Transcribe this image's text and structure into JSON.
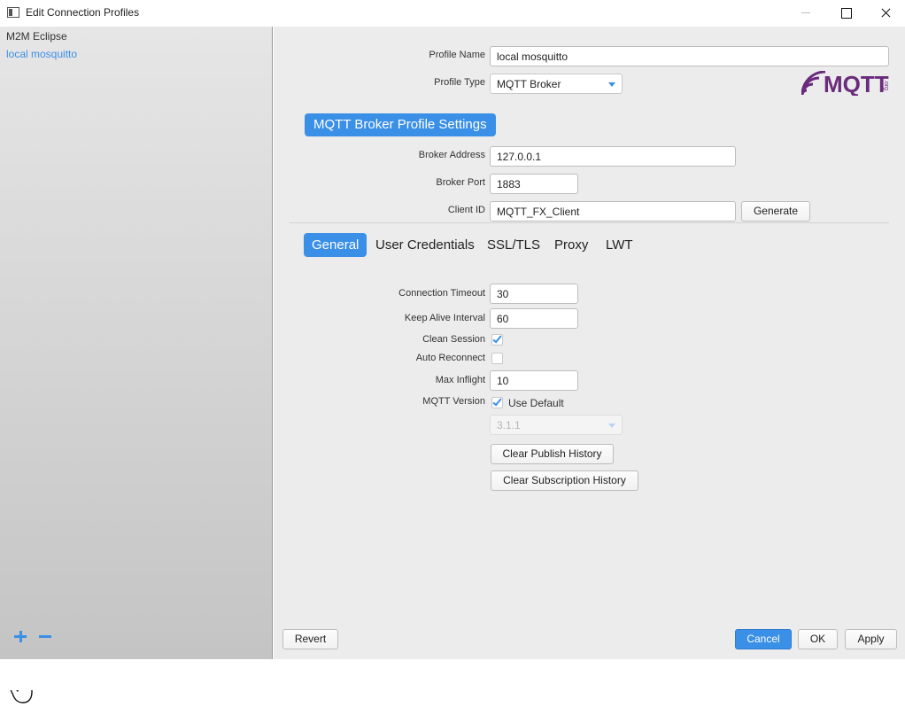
{
  "window": {
    "title": "Edit Connection Profiles"
  },
  "sidebar": {
    "profiles": [
      {
        "label": "M2M Eclipse"
      },
      {
        "label": "local mosquitto"
      }
    ]
  },
  "profile": {
    "name_label": "Profile Name",
    "name_value": "local mosquitto",
    "type_label": "Profile Type",
    "type_value": "MQTT Broker",
    "logo_text": "MQTT",
    "logo_subtext": ".org"
  },
  "broker": {
    "section_title": "MQTT Broker Profile Settings",
    "address_label": "Broker Address",
    "address_value": "127.0.0.1",
    "port_label": "Broker Port",
    "port_value": "1883",
    "client_id_label": "Client ID",
    "client_id_value": "MQTT_FX_Client",
    "generate_label": "Generate"
  },
  "tabs": [
    {
      "label": "General",
      "active": true
    },
    {
      "label": "User Credentials",
      "active": false
    },
    {
      "label": "SSL/TLS",
      "active": false
    },
    {
      "label": "Proxy",
      "active": false
    },
    {
      "label": "LWT",
      "active": false
    }
  ],
  "general": {
    "timeout_label": "Connection Timeout",
    "timeout_value": "30",
    "keepalive_label": "Keep Alive Interval",
    "keepalive_value": "60",
    "clean_session_label": "Clean Session",
    "clean_session_checked": true,
    "auto_reconnect_label": "Auto Reconnect",
    "auto_reconnect_checked": false,
    "max_inflight_label": "Max Inflight",
    "max_inflight_value": "10",
    "mqtt_version_label": "MQTT Version",
    "use_default_label": "Use Default",
    "use_default_checked": true,
    "version_value": "3.1.1",
    "clear_publish_label": "Clear Publish History",
    "clear_subscription_label": "Clear Subscription History"
  },
  "footer": {
    "revert_label": "Revert",
    "cancel_label": "Cancel",
    "ok_label": "OK",
    "apply_label": "Apply"
  },
  "colors": {
    "accent": "#3a8fe6",
    "logo_purple": "#6b2b7c"
  }
}
